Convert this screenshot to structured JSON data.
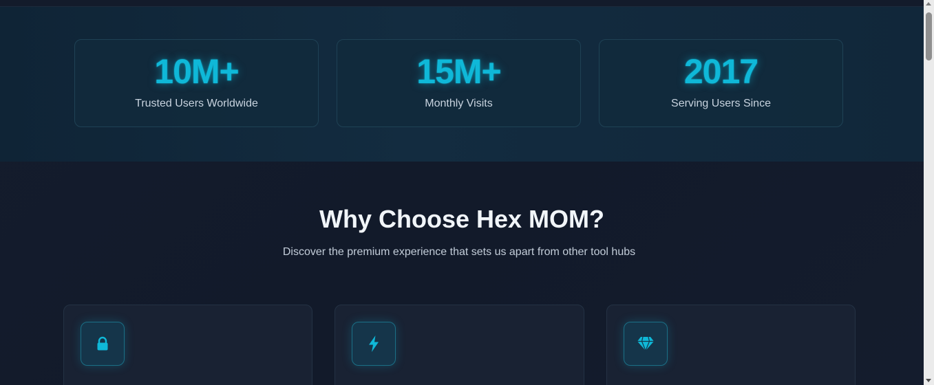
{
  "stats": [
    {
      "value": "10M+",
      "label": "Trusted Users Worldwide"
    },
    {
      "value": "15M+",
      "label": "Monthly Visits"
    },
    {
      "value": "2017",
      "label": "Serving Users Since"
    }
  ],
  "features_section": {
    "title": "Why Choose Hex MOM?",
    "subtitle": "Discover the premium experience that sets us apart from other tool hubs"
  },
  "feature_cards": [
    {
      "icon": "lock-icon"
    },
    {
      "icon": "lightning-icon"
    },
    {
      "icon": "gem-icon"
    }
  ],
  "colors": {
    "accent": "#0fb8d8",
    "background": "#131a2a",
    "stats_band": "#11283b",
    "card": "#192233"
  }
}
